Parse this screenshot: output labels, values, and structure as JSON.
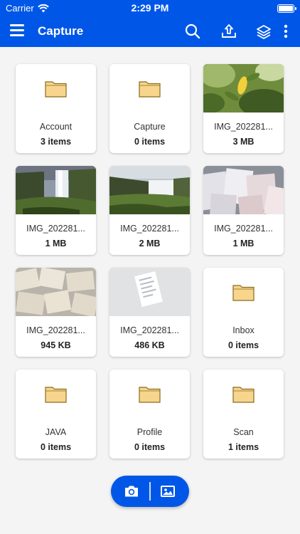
{
  "status_bar": {
    "carrier": "Carrier",
    "time": "2:29 PM",
    "wifi_icon": "wifi-icon",
    "battery_icon": "battery-icon"
  },
  "app_bar": {
    "title": "Capture",
    "menu_icon": "hamburger-menu-icon",
    "actions": [
      "search-icon",
      "upload-icon",
      "layers-upload-icon",
      "more-vertical-icon"
    ]
  },
  "colors": {
    "brand": "#0057e7",
    "folder_fill": "#f7d58c",
    "folder_stroke": "#8a6a1e",
    "card": "#ffffff",
    "background": "#f4f4f4"
  },
  "items": [
    {
      "type": "folder",
      "name": "Account",
      "meta": "3 items"
    },
    {
      "type": "folder",
      "name": "Capture",
      "meta": "0 items"
    },
    {
      "type": "image",
      "name": "IMG_202281...",
      "meta": "3 MB",
      "thumb": "lemon-tree"
    },
    {
      "type": "image",
      "name": "IMG_202281...",
      "meta": "1 MB",
      "thumb": "waterfall"
    },
    {
      "type": "image",
      "name": "IMG_202281...",
      "meta": "2 MB",
      "thumb": "waterfall-wide"
    },
    {
      "type": "image",
      "name": "IMG_202281...",
      "meta": "1 MB",
      "thumb": "papers"
    },
    {
      "type": "image",
      "name": "IMG_202281...",
      "meta": "945 KB",
      "thumb": "book-pages"
    },
    {
      "type": "image",
      "name": "IMG_202281...",
      "meta": "486 KB",
      "thumb": "document"
    },
    {
      "type": "folder",
      "name": "Inbox",
      "meta": "0 items"
    },
    {
      "type": "folder",
      "name": "JAVA",
      "meta": "0 items"
    },
    {
      "type": "folder",
      "name": "Profile",
      "meta": "0 items"
    },
    {
      "type": "folder",
      "name": "Scan",
      "meta": "1 items"
    }
  ],
  "bottom_actions": {
    "camera_icon": "camera-icon",
    "gallery_icon": "image-gallery-icon"
  }
}
